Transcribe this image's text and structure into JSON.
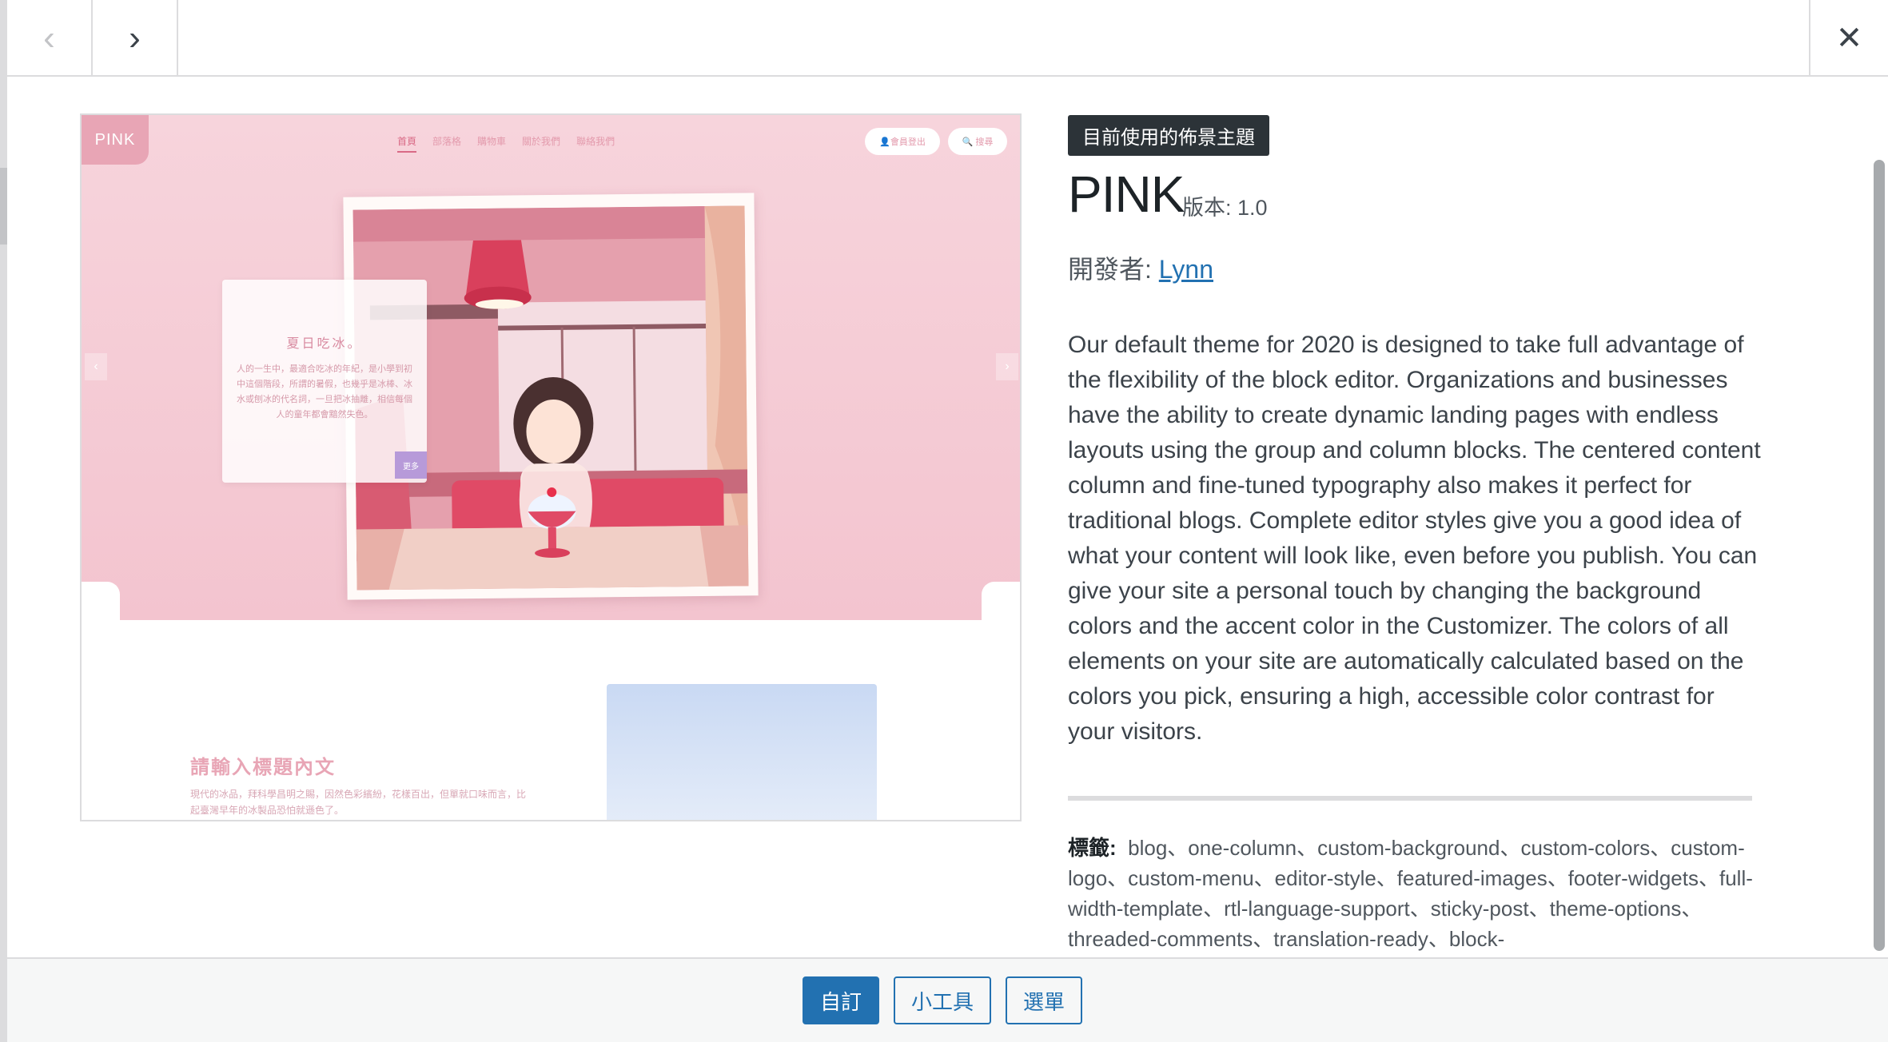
{
  "header": {
    "prev_icon": "‹",
    "next_icon": "›",
    "close_icon": "✕"
  },
  "screenshot": {
    "logo": "PINK",
    "nav": [
      "首頁",
      "部落格",
      "購物車",
      "關於我們",
      "聯絡我們"
    ],
    "login_pill": "👤會員登出",
    "search_pill": "🔍 搜尋",
    "card_title": "夏日吃冰。",
    "card_body": "人的一生中，最適合吃冰的年紀，是小學到初中這個階段，所謂的暑假，也幾乎是冰棒、冰水或刨冰的代名詞，一旦把冰抽離，相信每個人的童年都會黯然失色。",
    "card_more": "更多",
    "section_title": "請輸入標題內文",
    "section_text": "現代的冰品，拜科學昌明之賜，因然色彩繽紛，花樣百出，但單就口味而言，比起臺灣早年的冰製品恐怕就遜色了。",
    "arrow_left": "‹",
    "arrow_right": "›"
  },
  "theme": {
    "badge": "目前使用的佈景主題",
    "name": "PINK",
    "version": "版本: 1.0",
    "author_label": "開發者: ",
    "author_name": "Lynn",
    "description": "Our default theme for 2020 is designed to take full advantage of the flexibility of the block editor. Organizations and businesses have the ability to create dynamic landing pages with endless layouts using the group and column blocks. The centered content column and fine-tuned typography also makes it perfect for traditional blogs. Complete editor styles give you a good idea of what your content will look like, even before you publish. You can give your site a personal touch by changing the background colors and the accent color in the Customizer. The colors of all elements on your site are automatically calculated based on the colors you pick, ensuring a high, accessible color contrast for your visitors.",
    "tags_label": "標籤:",
    "tags": "blog、one-column、custom-background、custom-colors、custom-logo、custom-menu、editor-style、featured-images、footer-widgets、full-width-template、rtl-language-support、sticky-post、theme-options、threaded-comments、translation-ready、block-"
  },
  "footer": {
    "customize": "自訂",
    "widgets": "小工具",
    "menus": "選單"
  },
  "colors": {
    "accent": "#2271b1",
    "badge_bg": "#2c3338",
    "theme_pink": "#f3c4cf"
  }
}
